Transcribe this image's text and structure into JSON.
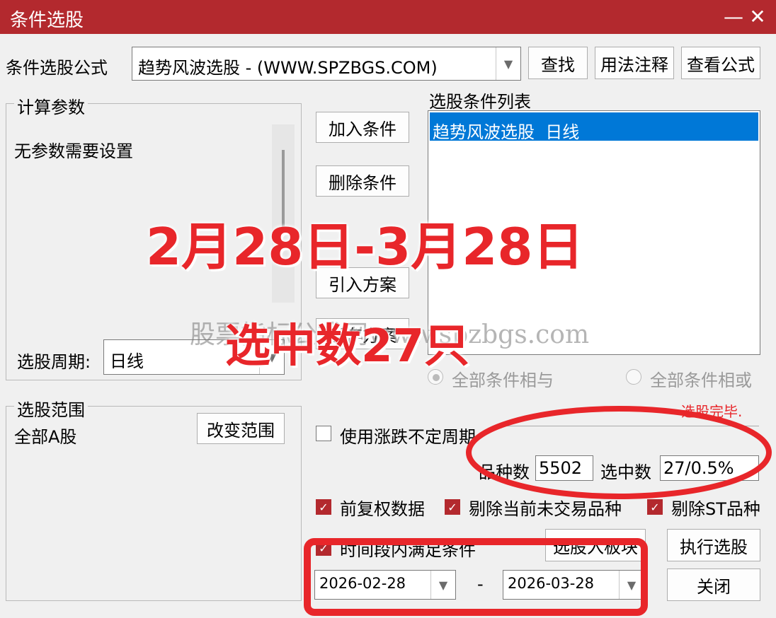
{
  "window": {
    "title": "条件选股",
    "minimize": "—",
    "close": "✕"
  },
  "formula": {
    "label": "条件选股公式",
    "value": "趋势风波选股  -  (WWW.SPZBGS.COM)",
    "buttons": {
      "find": "查找",
      "usage": "用法注释",
      "view": "查看公式"
    }
  },
  "params": {
    "group_label": "计算参数",
    "text": "无参数需要设置",
    "period_label": "选股周期:",
    "period_value": "日线"
  },
  "middle_buttons": {
    "add": "加入条件",
    "delete": "删除条件",
    "import": "引入方案",
    "save": "保存方案"
  },
  "conditions": {
    "label": "选股条件列表",
    "items": [
      "趋势风波选股  日线"
    ],
    "radio_and": "全部条件相与",
    "radio_or": "全部条件相或"
  },
  "status": "选股完毕.",
  "scope": {
    "group_label": "选股范围",
    "value": "全部A股",
    "change_button": "改变范围"
  },
  "options": {
    "use_uncertain_period": "使用涨跌不定周期",
    "count_label": "品种数",
    "count_value": "5502",
    "selected_label": "选中数",
    "selected_value": "27/0.5%",
    "pre_adjust": "前复权数据",
    "exclude_untraded": "剔除当前未交易品种",
    "exclude_st": "剔除ST品种",
    "time_range": "时间段内满足条件",
    "to_block_button": "选股入板块",
    "execute_button": "执行选股",
    "close_button": "关闭"
  },
  "dates": {
    "start": "2026-02-28",
    "separator": "-",
    "end": "2026-03-28"
  },
  "overlay": {
    "date_range": "2月28日-3月28日",
    "watermark": "股票指标公式网www.spzbgs.com",
    "selected_count": "选中数27只"
  },
  "colors": {
    "titlebar": "#b3292e",
    "selection": "#0078d7",
    "annotation": "#e8262a"
  }
}
